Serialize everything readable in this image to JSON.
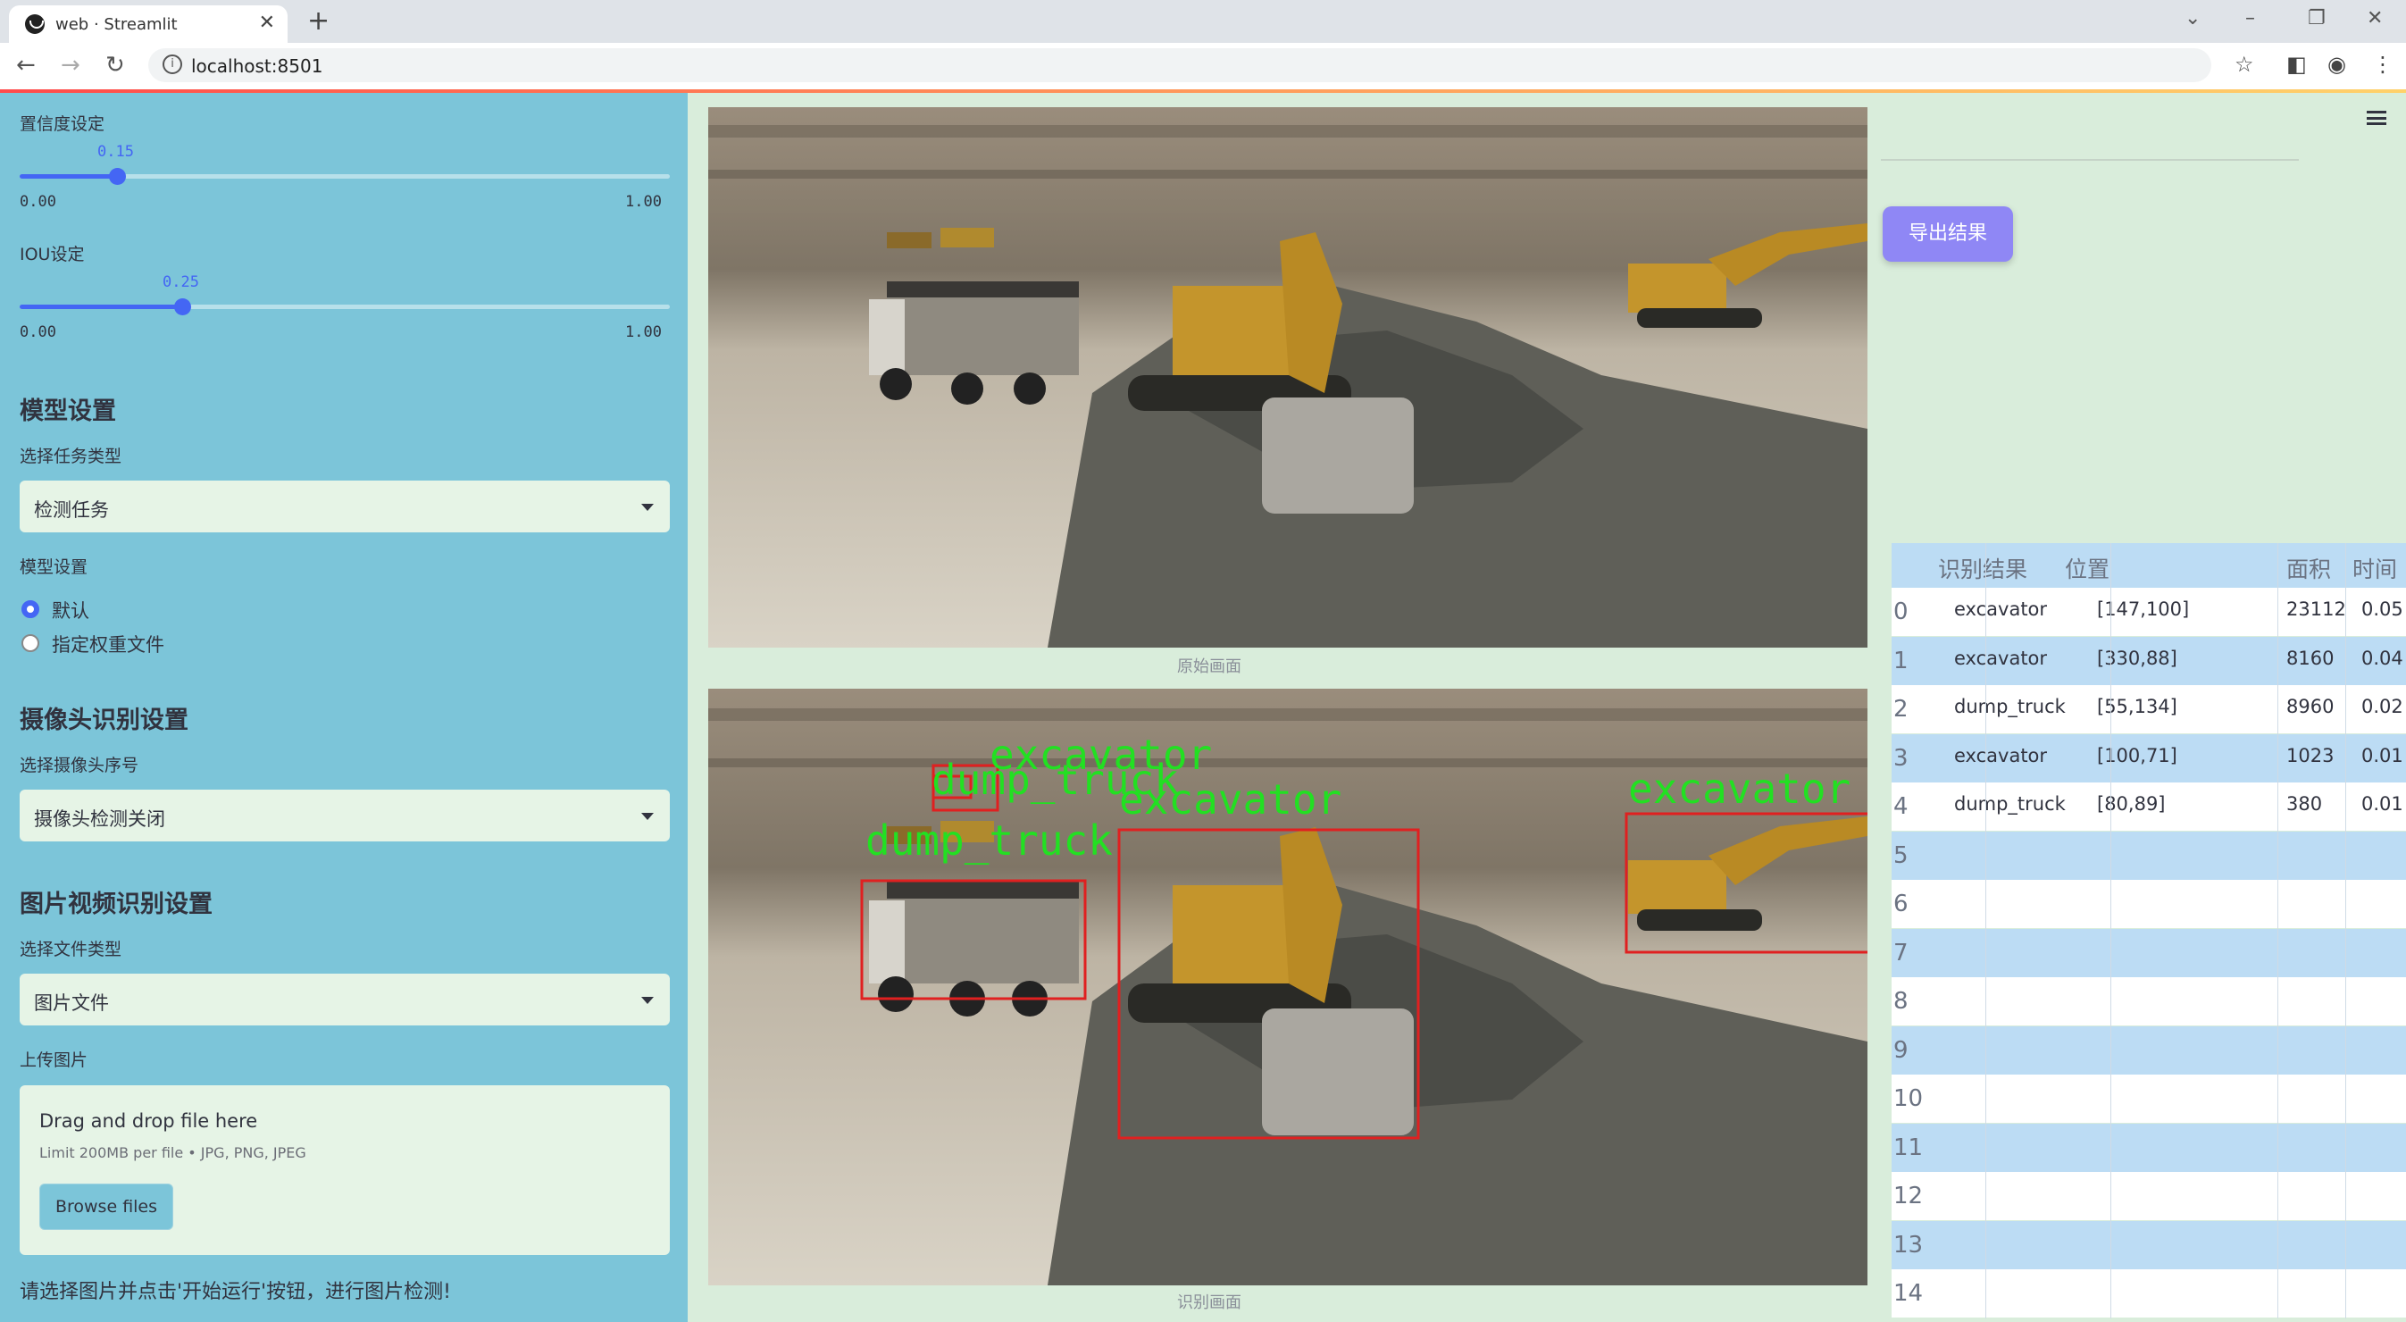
{
  "browser": {
    "tab_title": "web · Streamlit",
    "url": "localhost:8501"
  },
  "sidebar": {
    "confidence": {
      "label": "置信度设定",
      "value": "0.15",
      "min": "0.00",
      "max": "1.00",
      "fraction": 0.15
    },
    "iou": {
      "label": "IOU设定",
      "value": "0.25",
      "min": "0.00",
      "max": "1.00",
      "fraction": 0.25
    },
    "model_section": {
      "title": "模型设置",
      "task_label": "选择任务类型",
      "task_value": "检测任务",
      "model_label": "模型设置",
      "options": [
        "默认",
        "指定权重文件"
      ],
      "selected_index": 0
    },
    "camera_section": {
      "title": "摄像头识别设置",
      "camera_label": "选择摄像头序号",
      "camera_value": "摄像头检测关闭"
    },
    "media_section": {
      "title": "图片视频识别设置",
      "filetype_label": "选择文件类型",
      "filetype_value": "图片文件",
      "upload_label": "上传图片",
      "drop_text": "Drag and drop file here",
      "limit_text": "Limit 200MB per file • JPG, PNG, JPEG",
      "browse_label": "Browse files"
    },
    "hint": "请选择图片并点击'开始运行'按钮，进行图片检测!"
  },
  "main": {
    "original_caption": "原始画面",
    "result_caption": "识别画面",
    "detections_overlay": [
      {
        "label": "excavator"
      },
      {
        "label": "dump_truck"
      },
      {
        "label": "excavator"
      },
      {
        "label": "dump_truck"
      },
      {
        "label": "excavator"
      }
    ]
  },
  "right": {
    "export_label": "导出结果",
    "table": {
      "headers": [
        "识别结果",
        "位置",
        "面积",
        "时间"
      ],
      "rows": [
        {
          "idx": "0",
          "result": "excavator",
          "pos": "[147,100]",
          "area": "23112",
          "time": "0.05"
        },
        {
          "idx": "1",
          "result": "excavator",
          "pos": "[330,88]",
          "area": "8160",
          "time": "0.04"
        },
        {
          "idx": "2",
          "result": "dump_truck",
          "pos": "[55,134]",
          "area": "8960",
          "time": "0.02"
        },
        {
          "idx": "3",
          "result": "excavator",
          "pos": "[100,71]",
          "area": "1023",
          "time": "0.01"
        },
        {
          "idx": "4",
          "result": "dump_truck",
          "pos": "[80,89]",
          "area": "380",
          "time": "0.01"
        },
        {
          "idx": "5",
          "result": "",
          "pos": "",
          "area": "",
          "time": ""
        },
        {
          "idx": "6",
          "result": "",
          "pos": "",
          "area": "",
          "time": ""
        },
        {
          "idx": "7",
          "result": "",
          "pos": "",
          "area": "",
          "time": ""
        },
        {
          "idx": "8",
          "result": "",
          "pos": "",
          "area": "",
          "time": ""
        },
        {
          "idx": "9",
          "result": "",
          "pos": "",
          "area": "",
          "time": ""
        },
        {
          "idx": "10",
          "result": "",
          "pos": "",
          "area": "",
          "time": ""
        },
        {
          "idx": "11",
          "result": "",
          "pos": "",
          "area": "",
          "time": ""
        },
        {
          "idx": "12",
          "result": "",
          "pos": "",
          "area": "",
          "time": ""
        },
        {
          "idx": "13",
          "result": "",
          "pos": "",
          "area": "",
          "time": ""
        },
        {
          "idx": "14",
          "result": "",
          "pos": "",
          "area": "",
          "time": ""
        }
      ]
    }
  },
  "colors": {
    "sidebar_bg": "#7cc5d9",
    "main_bg": "#d9eddb",
    "accent": "#4466f4",
    "export_button": "#8f87f5",
    "box_red": "#e02020",
    "label_green": "#22e022"
  }
}
